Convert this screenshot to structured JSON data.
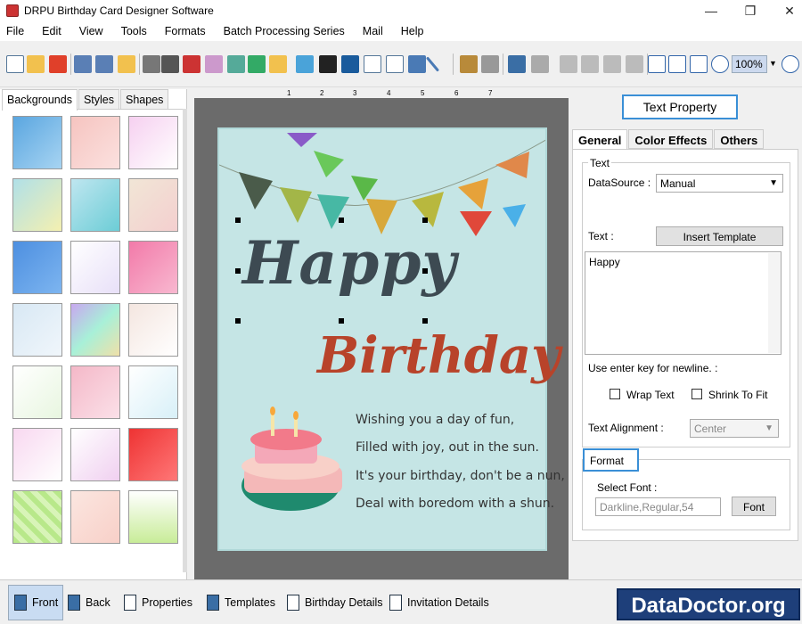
{
  "window": {
    "title": "DRPU Birthday Card Designer Software"
  },
  "menu": [
    "File",
    "Edit",
    "View",
    "Tools",
    "Formats",
    "Batch Processing Series",
    "Mail",
    "Help"
  ],
  "toolbar": {
    "zoom": "100%"
  },
  "left_tabs": [
    "Backgrounds",
    "Styles",
    "Shapes"
  ],
  "ruler_top": [
    "1",
    "2",
    "3",
    "4",
    "5",
    "6",
    "7"
  ],
  "card": {
    "title_line1": "Happy",
    "title_line2": "Birthday",
    "poem": [
      "Wishing you a day of fun,",
      "Filled with joy, out in the sun.",
      "It's your birthday, don't be a nun,",
      "Deal with boredom with a shun."
    ]
  },
  "right": {
    "header": "Text Property",
    "tabs": [
      "General",
      "Color Effects",
      "Others"
    ],
    "text_group": "Text",
    "datasource_label": "DataSource :",
    "datasource_value": "Manual",
    "text_label": "Text :",
    "insert_template": "Insert Template",
    "text_value": "Happy",
    "newline_hint": "Use enter key for newline. :",
    "wrap_text": "Wrap Text",
    "shrink_fit": "Shrink To Fit",
    "alignment_label": "Text Alignment :",
    "alignment_value": "Center",
    "format_group": "Format",
    "select_font_label": "Select Font :",
    "font_value": "Darkline,Regular,54",
    "font_button": "Font"
  },
  "bottom": {
    "buttons": [
      "Front",
      "Back",
      "Properties",
      "Templates",
      "Birthday Details",
      "Invitation Details"
    ],
    "logo": "DataDoctor.org"
  }
}
